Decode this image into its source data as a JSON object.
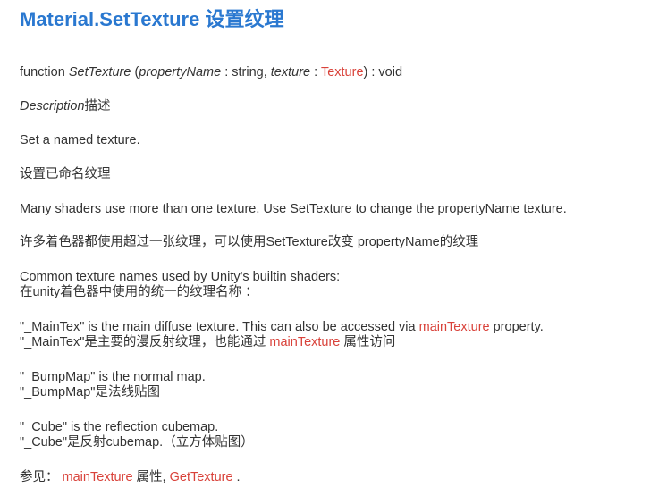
{
  "title": "Material.SetTexture 设置纹理",
  "signature": {
    "keyword": "function",
    "name": "SetTexture",
    "open": "(",
    "param1_name": "propertyName",
    "param1_type": " : string, ",
    "param2_name": "texture",
    "sep": " : ",
    "param2_type": "Texture",
    "close": ") : void"
  },
  "description": {
    "label": "Description",
    "label_cn": "描述"
  },
  "paragraphs": {
    "set_en": "Set a named texture.",
    "set_cn": "设置已命名纹理",
    "many_en": "Many shaders use more than one texture. Use SetTexture to change the propertyName texture.",
    "many_cn": "许多着色器都使用超过一张纹理，可以使用SetTexture改变 propertyName的纹理",
    "common_en": "Common texture names used by Unity's builtin shaders:",
    "common_cn": "在unity着色器中使用的统一的纹理名称 ：",
    "maintex_en_a": "\"_MainTex\" is the main diffuse texture. This can also be accessed via ",
    "maintex_en_link": "mainTexture",
    "maintex_en_b": " property.",
    "maintex_cn_a": "\"_MainTex\"是主要的漫反射纹理，也能通过 ",
    "maintex_cn_link": "mainTexture",
    "maintex_cn_b": " 属性访问",
    "bump_en": "\"_BumpMap\" is the normal map.",
    "bump_cn": "\"_BumpMap\"是法线贴图",
    "cube_en": "\"_Cube\" is the reflection cubemap.",
    "cube_cn": "\"_Cube\"是反射cubemap.（立方体贴图）",
    "see_label": "参见： ",
    "see_link1": "mainTexture",
    "see_mid": " 属性, ",
    "see_link2": "GetTexture",
    "see_end": " ."
  },
  "colors": {
    "title": "#2a78d0",
    "link": "#d9423a",
    "text": "#333333"
  }
}
